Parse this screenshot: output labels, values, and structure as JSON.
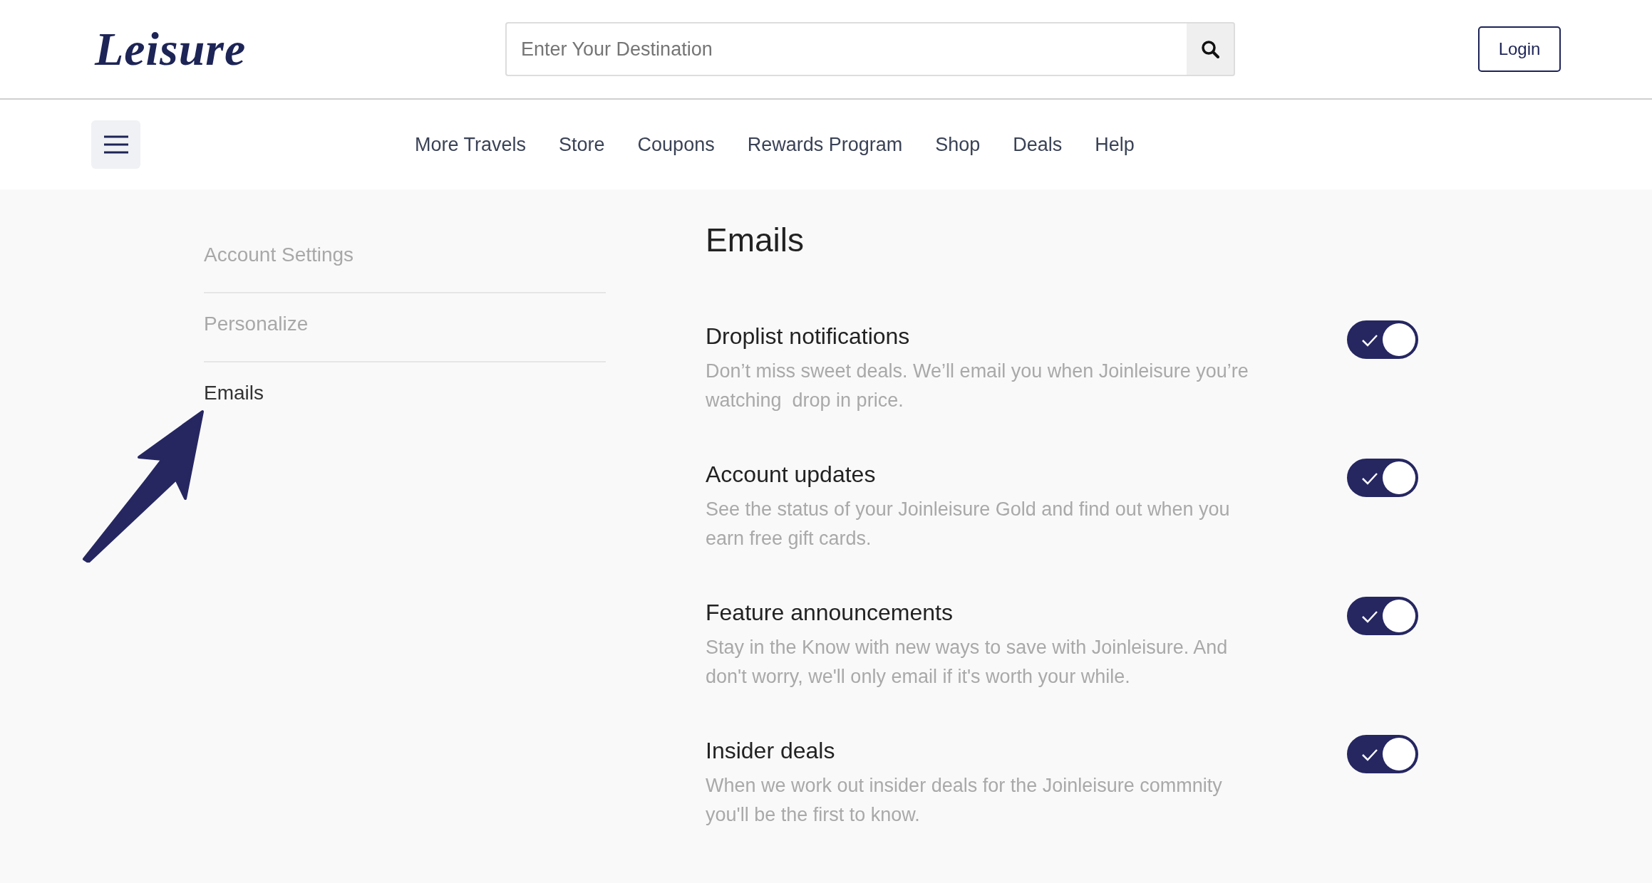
{
  "header": {
    "logo": "Leisure",
    "search": {
      "placeholder": "Enter Your Destination"
    },
    "login": "Login"
  },
  "nav": {
    "items": [
      "More Travels",
      "Store",
      "Coupons",
      "Rewards Program",
      "Shop",
      "Deals",
      "Help"
    ]
  },
  "sidebar": {
    "items": [
      {
        "label": "Account Settings",
        "selected": false
      },
      {
        "label": "Personalize",
        "selected": false
      },
      {
        "label": "Emails",
        "selected": true
      }
    ]
  },
  "page": {
    "title": "Emails"
  },
  "settings": [
    {
      "title": "Droplist notifications",
      "description": "Don’t miss sweet deals. We’ll email you when Joinleisure you’re watching  drop in price.",
      "on": true
    },
    {
      "title": "Account updates",
      "description": "See the status of your Joinleisure Gold and find out when you earn free gift cards.",
      "on": true
    },
    {
      "title": "Feature announcements",
      "description": "Stay in the Know with new ways to save with Joinleisure. And don't worry, we'll only email if it's worth your while.",
      "on": true
    },
    {
      "title": "Insider deals",
      "description": "When we work out insider deals for the Joinleisure commnity you'll be the first to know.",
      "on": true
    }
  ]
}
